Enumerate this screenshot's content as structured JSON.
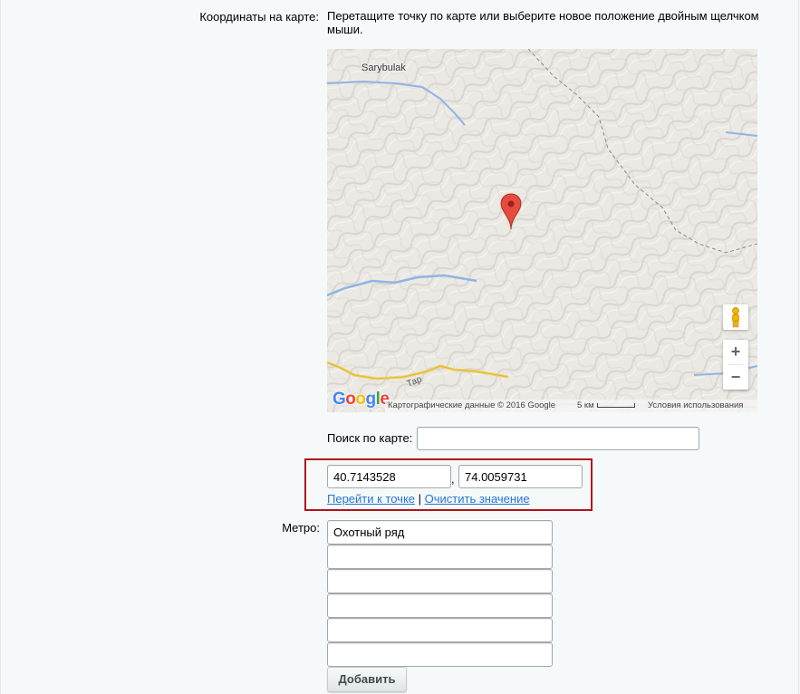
{
  "coordinates": {
    "label": "Координаты на карте:",
    "hint": "Перетащите точку по карте или выберите новое положение двойным щелчком мыши."
  },
  "map": {
    "place_label": "Sarybulak",
    "road_label": "Тар",
    "logo": "Google",
    "attribution": "Картографические данные © 2016 Google",
    "scale_label": "5 км",
    "terms": "Условия использования",
    "zoom_in": "+",
    "zoom_out": "−",
    "icons": [
      "map-marker-icon",
      "pegman-icon",
      "google-logo"
    ]
  },
  "search": {
    "label": "Поиск по карте:",
    "value": ""
  },
  "coords_inputs": {
    "lat": "40.7143528",
    "separator": ",",
    "lng": "74.0059731",
    "go_link": "Перейти к точке",
    "link_separator": " | ",
    "clear_link": "Очистить значение"
  },
  "metro": {
    "label": "Метро:",
    "values": [
      "Охотный ряд",
      "",
      "",
      "",
      "",
      ""
    ],
    "add_label": "Добавить"
  },
  "colors": {
    "link": "#2675d7",
    "highlight": "#b3121c",
    "marker": "#e54c40"
  }
}
